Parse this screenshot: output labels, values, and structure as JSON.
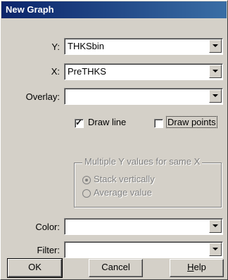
{
  "window": {
    "title": "New Graph"
  },
  "fields": {
    "y": {
      "label": "Y:",
      "value": "THKSbin"
    },
    "x": {
      "label": "X:",
      "value": "PreTHKS"
    },
    "overlay": {
      "label": "Overlay:",
      "value": ""
    },
    "color": {
      "label": "Color:",
      "value": ""
    },
    "filter": {
      "label": "Filter:",
      "value": ""
    }
  },
  "options": {
    "draw_line": {
      "label": "Draw line",
      "checked": true
    },
    "draw_points": {
      "label": "Draw points",
      "checked": false
    }
  },
  "multiple_y": {
    "legend": "Multiple Y values for same X",
    "stack": {
      "label": "Stack vertically",
      "selected": true
    },
    "average": {
      "label": "Average value",
      "selected": false
    }
  },
  "buttons": {
    "ok": "OK",
    "cancel": "Cancel",
    "help": "Help"
  },
  "icons": {
    "dropdown": "chevron-down-icon",
    "check": "checkmark-icon"
  }
}
